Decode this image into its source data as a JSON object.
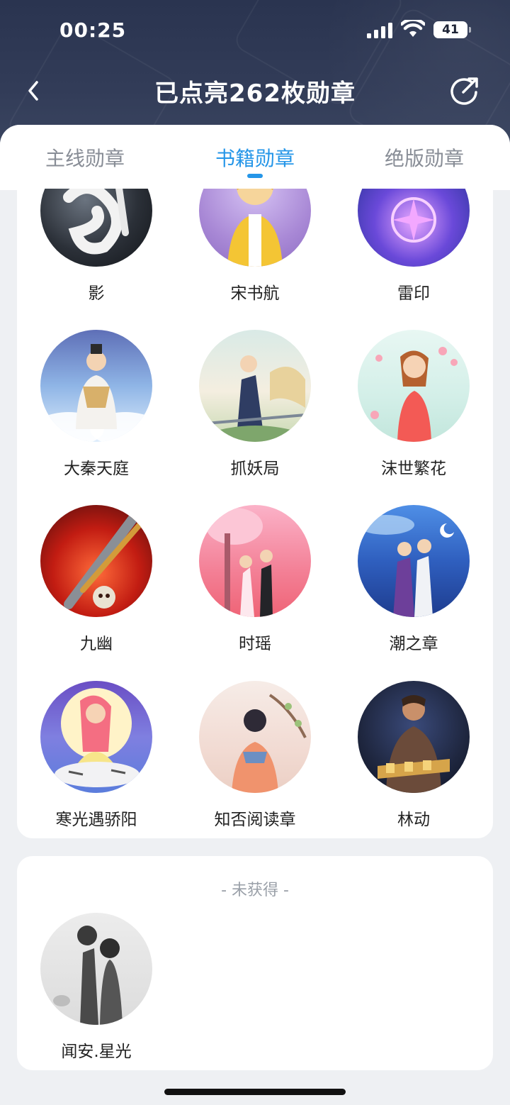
{
  "status": {
    "time": "00:25",
    "battery": "41"
  },
  "nav": {
    "title": "已点亮262枚勋章"
  },
  "tabs": [
    {
      "label": "主线勋章",
      "active": false
    },
    {
      "label": "书籍勋章",
      "active": true
    },
    {
      "label": "绝版勋章",
      "active": false
    }
  ],
  "owned_badges": [
    {
      "name": "影"
    },
    {
      "name": "宋书航"
    },
    {
      "name": "雷印"
    },
    {
      "name": "大秦天庭"
    },
    {
      "name": "抓妖局"
    },
    {
      "name": "沫世繁花"
    },
    {
      "name": "九幽"
    },
    {
      "name": "时瑶"
    },
    {
      "name": "潮之章"
    },
    {
      "name": "寒光遇骄阳"
    },
    {
      "name": "知否阅读章"
    },
    {
      "name": "林动"
    }
  ],
  "locked_section": {
    "label": "- 未获得 -",
    "badges": [
      {
        "name": "闻安.星光"
      }
    ]
  },
  "colors": {
    "accent": "#2596e8",
    "header_bg": "#2a3450"
  }
}
